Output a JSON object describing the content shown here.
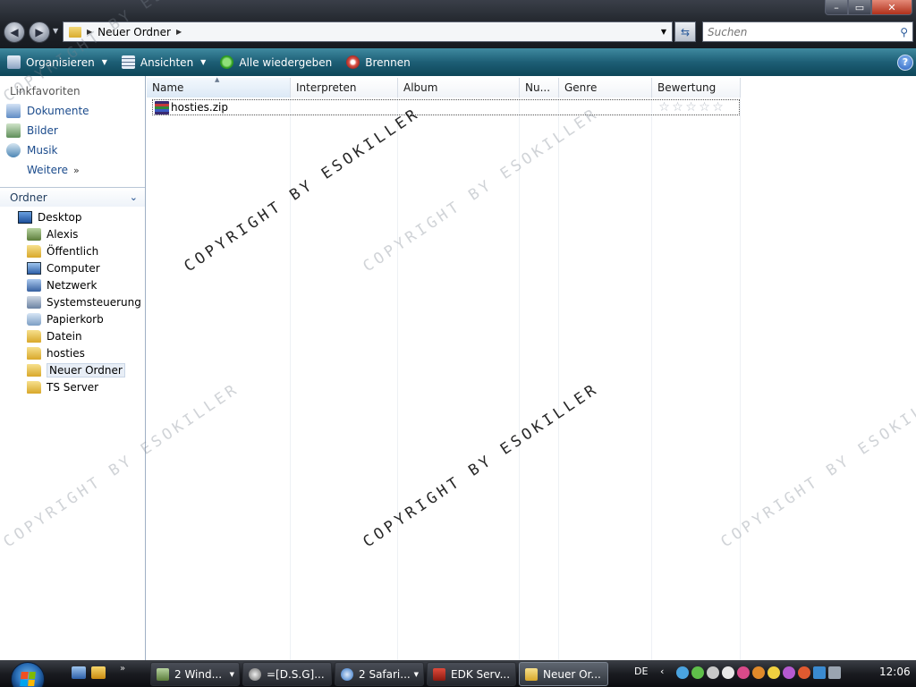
{
  "window": {
    "address_path": "Neuer Ordner",
    "search_placeholder": "Suchen",
    "controls": {
      "minimize": "–",
      "maximize": "▭",
      "close": "✕"
    }
  },
  "toolbar": {
    "organize_label": "Organisieren",
    "views_label": "Ansichten",
    "play_all_label": "Alle wiedergeben",
    "burn_label": "Brennen",
    "help_label": "?"
  },
  "navigation": {
    "favorites_header": "Linkfavoriten",
    "favorites": [
      "Dokumente",
      "Bilder",
      "Musik"
    ],
    "more_label": "Weitere",
    "folders_header": "Ordner",
    "tree": [
      "Desktop",
      "Alexis",
      "Öffentlich",
      "Computer",
      "Netzwerk",
      "Systemsteuerung",
      "Papierkorb",
      "Datein",
      "hosties",
      "Neuer Ordner",
      "TS Server"
    ],
    "selected": "Neuer Ordner"
  },
  "columns": [
    "Name",
    "Interpreten",
    "Album",
    "Nu...",
    "Genre",
    "Bewertung"
  ],
  "files": [
    {
      "name": "hosties.zip",
      "rating": 0,
      "rating_max": 5
    }
  ],
  "watermark_text": "COPYRIGHT BY ESOKILLER",
  "taskbar": {
    "tasks": [
      "2 Wind...",
      "=[D.S.G]...",
      "2 Safari...",
      "EDK Serv...",
      "Neuer Or..."
    ],
    "active_task": "Neuer Or...",
    "language": "DE",
    "clock": "12:06"
  },
  "icons": {
    "back": "arrow-left-icon",
    "forward": "arrow-right-icon",
    "refresh": "refresh-icon",
    "search": "magnifier-icon",
    "file": "zip-archive-icon",
    "start": "windows-logo-icon"
  },
  "colors": {
    "toolbar_accent": "#1d5e75",
    "link_blue": "#1b4b8c",
    "taskbar": "#1a1c21"
  }
}
